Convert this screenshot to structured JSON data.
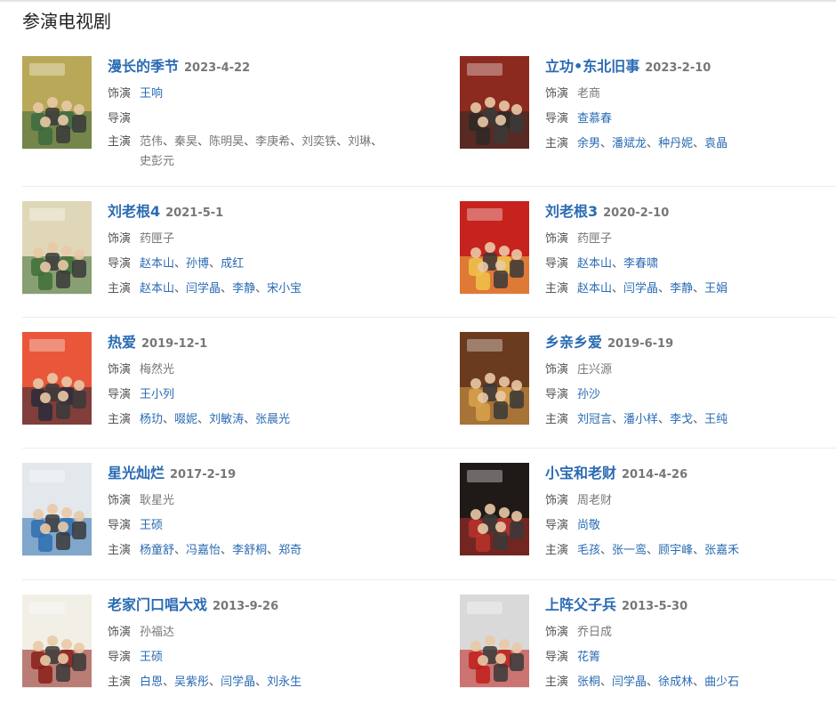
{
  "section": {
    "title": "参演电视剧"
  },
  "cards": [
    {
      "title": "漫长的季节",
      "date": "2023-4-22",
      "role_label": "饰演",
      "role": "王响",
      "role_link": true,
      "director_label": "导演",
      "directors": [],
      "cast_label": "主演",
      "cast": [
        "范伟",
        "秦昊",
        "陈明昊",
        "李庚希",
        "刘奕铁",
        "刘琳",
        "史彭元"
      ],
      "cast_plain": true,
      "poster": {
        "bg": "#b9a857",
        "accent": "#3d6a3f"
      }
    },
    {
      "title": "立功•东北旧事",
      "date": "2023-2-10",
      "role_label": "饰演",
      "role": "老商",
      "role_link": false,
      "director_label": "导演",
      "directors": [
        "查慕春"
      ],
      "cast_label": "主演",
      "cast": [
        "余男",
        "潘斌龙",
        "种丹妮",
        "袁晶"
      ],
      "cast_plain": false,
      "poster": {
        "bg": "#8c2a20",
        "accent": "#2e2a26"
      }
    },
    {
      "title": "刘老根4",
      "date": "2021-5-1",
      "role_label": "饰演",
      "role": "药匣子",
      "role_link": false,
      "director_label": "导演",
      "directors": [
        "赵本山",
        "孙博",
        "成红"
      ],
      "cast_label": "主演",
      "cast": [
        "赵本山",
        "闫学晶",
        "李静",
        "宋小宝"
      ],
      "cast_plain": false,
      "poster": {
        "bg": "#dfd7b8",
        "accent": "#3f6f3a"
      }
    },
    {
      "title": "刘老根3",
      "date": "2020-2-10",
      "role_label": "饰演",
      "role": "药匣子",
      "role_link": false,
      "director_label": "导演",
      "directors": [
        "赵本山",
        "李春啸"
      ],
      "cast_label": "主演",
      "cast": [
        "赵本山",
        "闫学晶",
        "李静",
        "王娟"
      ],
      "cast_plain": false,
      "poster": {
        "bg": "#c7231e",
        "accent": "#f1c34a"
      }
    },
    {
      "title": "热爱",
      "date": "2019-12-1",
      "role_label": "饰演",
      "role": "梅然光",
      "role_link": false,
      "director_label": "导演",
      "directors": [
        "王小列"
      ],
      "cast_label": "主演",
      "cast": [
        "杨玏",
        "啜妮",
        "刘敏涛",
        "张晨光"
      ],
      "cast_plain": false,
      "poster": {
        "bg": "#e9563a",
        "accent": "#2b2b3b"
      }
    },
    {
      "title": "乡亲乡爱",
      "date": "2019-6-19",
      "role_label": "饰演",
      "role": "庄兴源",
      "role_link": false,
      "director_label": "导演",
      "directors": [
        "孙沙"
      ],
      "cast_label": "主演",
      "cast": [
        "刘冠言",
        "潘小样",
        "李戈",
        "王纯"
      ],
      "cast_plain": false,
      "poster": {
        "bg": "#6b3b1d",
        "accent": "#d8a24a"
      }
    },
    {
      "title": "星光灿烂",
      "date": "2017-2-19",
      "role_label": "饰演",
      "role": "耿星光",
      "role_link": false,
      "director_label": "导演",
      "directors": [
        "王硕"
      ],
      "cast_label": "主演",
      "cast": [
        "杨童舒",
        "冯嘉怡",
        "李舒桐",
        "郑奇"
      ],
      "cast_plain": false,
      "poster": {
        "bg": "#e3e8ec",
        "accent": "#2f6fb0"
      }
    },
    {
      "title": "小宝和老财",
      "date": "2014-4-26",
      "role_label": "饰演",
      "role": "周老财",
      "role_link": false,
      "director_label": "导演",
      "directors": [
        "尚敬"
      ],
      "cast_label": "主演",
      "cast": [
        "毛孩",
        "张一鸾",
        "顾宇峰",
        "张嘉禾"
      ],
      "cast_plain": false,
      "poster": {
        "bg": "#1f1a17",
        "accent": "#b8322a"
      }
    },
    {
      "title": "老家门口唱大戏",
      "date": "2013-9-26",
      "role_label": "饰演",
      "role": "孙福达",
      "role_link": false,
      "director_label": "导演",
      "directors": [
        "王硕"
      ],
      "cast_label": "主演",
      "cast": [
        "白恩",
        "吴紫彤",
        "闫学晶",
        "刘永生"
      ],
      "cast_plain": false,
      "poster": {
        "bg": "#f2efe6",
        "accent": "#8a1f1a"
      }
    },
    {
      "title": "上阵父子兵",
      "date": "2013-5-30",
      "role_label": "饰演",
      "role": "乔日成",
      "role_link": false,
      "director_label": "导演",
      "directors": [
        "花箐"
      ],
      "cast_label": "主演",
      "cast": [
        "张桐",
        "闫学晶",
        "徐成林",
        "曲少石"
      ],
      "cast_plain": false,
      "poster": {
        "bg": "#d9d9d9",
        "accent": "#c0201c"
      }
    }
  ]
}
